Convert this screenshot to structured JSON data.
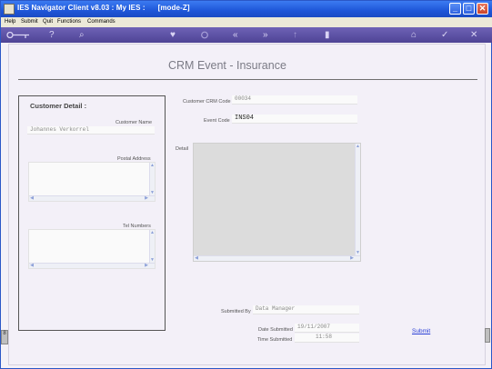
{
  "window": {
    "title": "IES Navigator Client v8.03 : My IES :      [mode-Z]",
    "minimize": "_",
    "maximize": "□",
    "close": "✕"
  },
  "menu": [
    "Help",
    "Submit",
    "Quit",
    "Functions",
    "Commands"
  ],
  "toolbar": {
    "key_icon": "key-icon",
    "help": "?",
    "search": "⌕",
    "heart": "♥",
    "back": "«",
    "forward": "»",
    "up": "↑",
    "doc": "▮",
    "home": "⌂",
    "ok": "✓",
    "close": "✕"
  },
  "page": {
    "heading": "CRM Event  - Insurance",
    "customer_detail": {
      "title": "Customer Detail :",
      "customer_name_label": "Customer Name",
      "customer_name_value": "Johannes Verkorrel",
      "postal_address_label": "Postal Address",
      "tel_numbers_label": "Tel Numbers"
    },
    "customer_crm_code_label": "Customer CRM Code",
    "customer_crm_code_value": "00034",
    "event_code_label": "Event Code",
    "event_code_value": "INS04",
    "detail_label": "Detail",
    "submitted_by_label": "Submitted By",
    "submitted_by_value": "Data Manager",
    "date_submitted_label": "Date Submitted",
    "date_submitted_value": "19/11/2007",
    "time_submitted_label": "Time Submitted",
    "time_submitted_value": "11:58",
    "submit_link": "Submit"
  },
  "colors": {
    "titlebar": "#1e56d8",
    "toolbar": "#5a4ea6",
    "link": "#2a3fd6"
  }
}
